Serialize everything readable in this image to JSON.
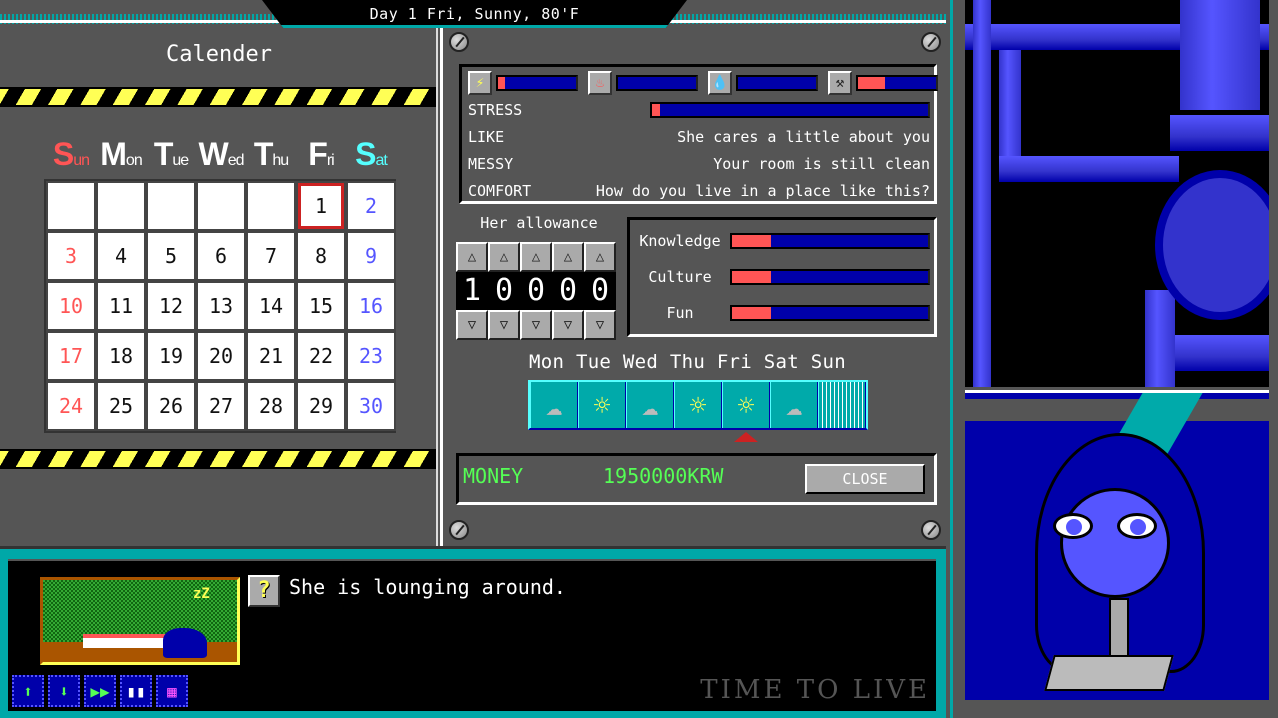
{
  "header": {
    "title": "Day 1 Fri, Sunny, 80'F"
  },
  "calendar": {
    "title": "Calender",
    "weekdays": [
      {
        "big": "S",
        "small": "un",
        "type": "sun"
      },
      {
        "big": "M",
        "small": "on",
        "type": "weekday"
      },
      {
        "big": "T",
        "small": "ue",
        "type": "weekday"
      },
      {
        "big": "W",
        "small": "ed",
        "type": "weekday"
      },
      {
        "big": "T",
        "small": "hu",
        "type": "weekday"
      },
      {
        "big": "F",
        "small": "ri",
        "type": "weekday"
      },
      {
        "big": "S",
        "small": "at",
        "type": "sat"
      }
    ],
    "leading_blanks": 5,
    "days": [
      "1",
      "2",
      "3",
      "4",
      "5",
      "6",
      "7",
      "8",
      "9",
      "10",
      "11",
      "12",
      "13",
      "14",
      "15",
      "16",
      "17",
      "18",
      "19",
      "20",
      "21",
      "22",
      "23",
      "24",
      "25",
      "26",
      "27",
      "28",
      "29",
      "30"
    ],
    "today": "1"
  },
  "stats": {
    "icons": [
      {
        "name": "energy-icon",
        "glyph": "⚡",
        "color": "#ffff55",
        "fill": 0.09
      },
      {
        "name": "fire-icon",
        "glyph": "♨",
        "color": "#ff5555",
        "fill": 0.0
      },
      {
        "name": "water-drop-icon",
        "glyph": "💧",
        "color": "#5555ff",
        "fill": 0.0
      },
      {
        "name": "hammer-icon",
        "glyph": "⚒",
        "color": "#222222",
        "fill": 0.34
      }
    ],
    "stress": {
      "label": "STRESS",
      "fill": 0.03
    },
    "like": {
      "label": "LIKE",
      "value": "She cares a little about you"
    },
    "messy": {
      "label": "MESSY",
      "value": "Your room is still clean"
    },
    "comfort": {
      "label": "COMFORT",
      "value": "How do you live in a place like this?"
    }
  },
  "allowance": {
    "label": "Her allowance",
    "digits": [
      "1",
      "0",
      "0",
      "0",
      "0"
    ],
    "up_glyph": "△",
    "down_glyph": "▽"
  },
  "skills": [
    {
      "label": "Knowledge",
      "fill": 0.2
    },
    {
      "label": "Culture",
      "fill": 0.2
    },
    {
      "label": "Fun",
      "fill": 0.2
    }
  ],
  "forecast": {
    "days_label": "Mon Tue Wed Thu Fri Sat Sun",
    "days": [
      {
        "day": "Mon",
        "weather": "cloudy",
        "glyph": "☁"
      },
      {
        "day": "Tue",
        "weather": "sunny",
        "glyph": "☼"
      },
      {
        "day": "Wed",
        "weather": "cloudy",
        "glyph": "☁"
      },
      {
        "day": "Thu",
        "weather": "sunny",
        "glyph": "☼"
      },
      {
        "day": "Fri",
        "weather": "sunny",
        "glyph": "☼"
      },
      {
        "day": "Sat",
        "weather": "cloudy",
        "glyph": "☁"
      },
      {
        "day": "Sun",
        "weather": "rain",
        "glyph": ""
      }
    ],
    "current_index": 4
  },
  "money": {
    "label": "MONEY",
    "value": "1950000KRW",
    "close_label": "CLOSE"
  },
  "message": {
    "help_glyph": "?",
    "text": "She is lounging around.",
    "scene_sleep": "zZ",
    "watermark": "TIME TO LIVE"
  },
  "toolbar": [
    {
      "name": "save-icon",
      "glyph": "⬆",
      "cls": "save"
    },
    {
      "name": "load-icon",
      "glyph": "⬇",
      "cls": "load"
    },
    {
      "name": "fast-forward-icon",
      "glyph": "▶▶",
      "cls": "skip"
    },
    {
      "name": "book-icon",
      "glyph": "▮▮",
      "cls": "book"
    },
    {
      "name": "schedule-icon",
      "glyph": "▦",
      "cls": "sched"
    }
  ]
}
